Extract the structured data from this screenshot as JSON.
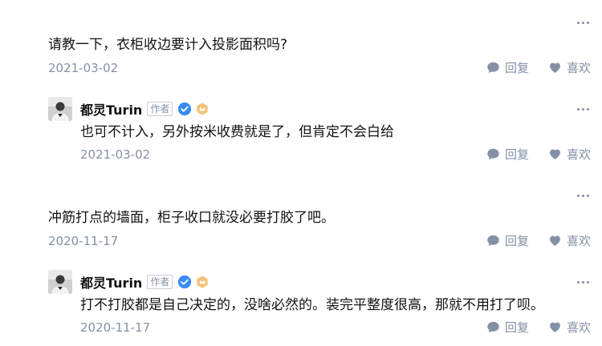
{
  "comments": [
    {
      "text": "请教一下，衣柜收边要计入投影面积吗?",
      "date": "2021-03-02",
      "reply_label": "回复",
      "like_label": "喜欢",
      "reply": {
        "author": "都灵Turin",
        "role": "作者",
        "text": "也可不计入，另外按米收费就是了，但肯定不会白给",
        "date": "2021-03-02",
        "reply_label": "回复",
        "like_label": "喜欢"
      }
    },
    {
      "text": "冲筋打点的墙面，柜子收口就没必要打胶了吧。",
      "date": "2020-11-17",
      "reply_label": "回复",
      "like_label": "喜欢",
      "reply": {
        "author": "都灵Turin",
        "role": "作者",
        "text": "打不打胶都是自己决定的，没啥必然的。装完平整度很高，那就不用打了呗。",
        "date": "2020-11-17",
        "reply_label": "回复",
        "like_label": "喜欢"
      }
    }
  ],
  "colors": {
    "meta": "#8590a6",
    "text": "#121212",
    "verified": "#3a8bf5",
    "level": "#e0a850"
  },
  "icons": {
    "more": "more-icon",
    "reply": "comment-bubble-icon",
    "like": "heart-icon",
    "verified": "verified-badge-icon",
    "level": "crown-level-icon"
  }
}
